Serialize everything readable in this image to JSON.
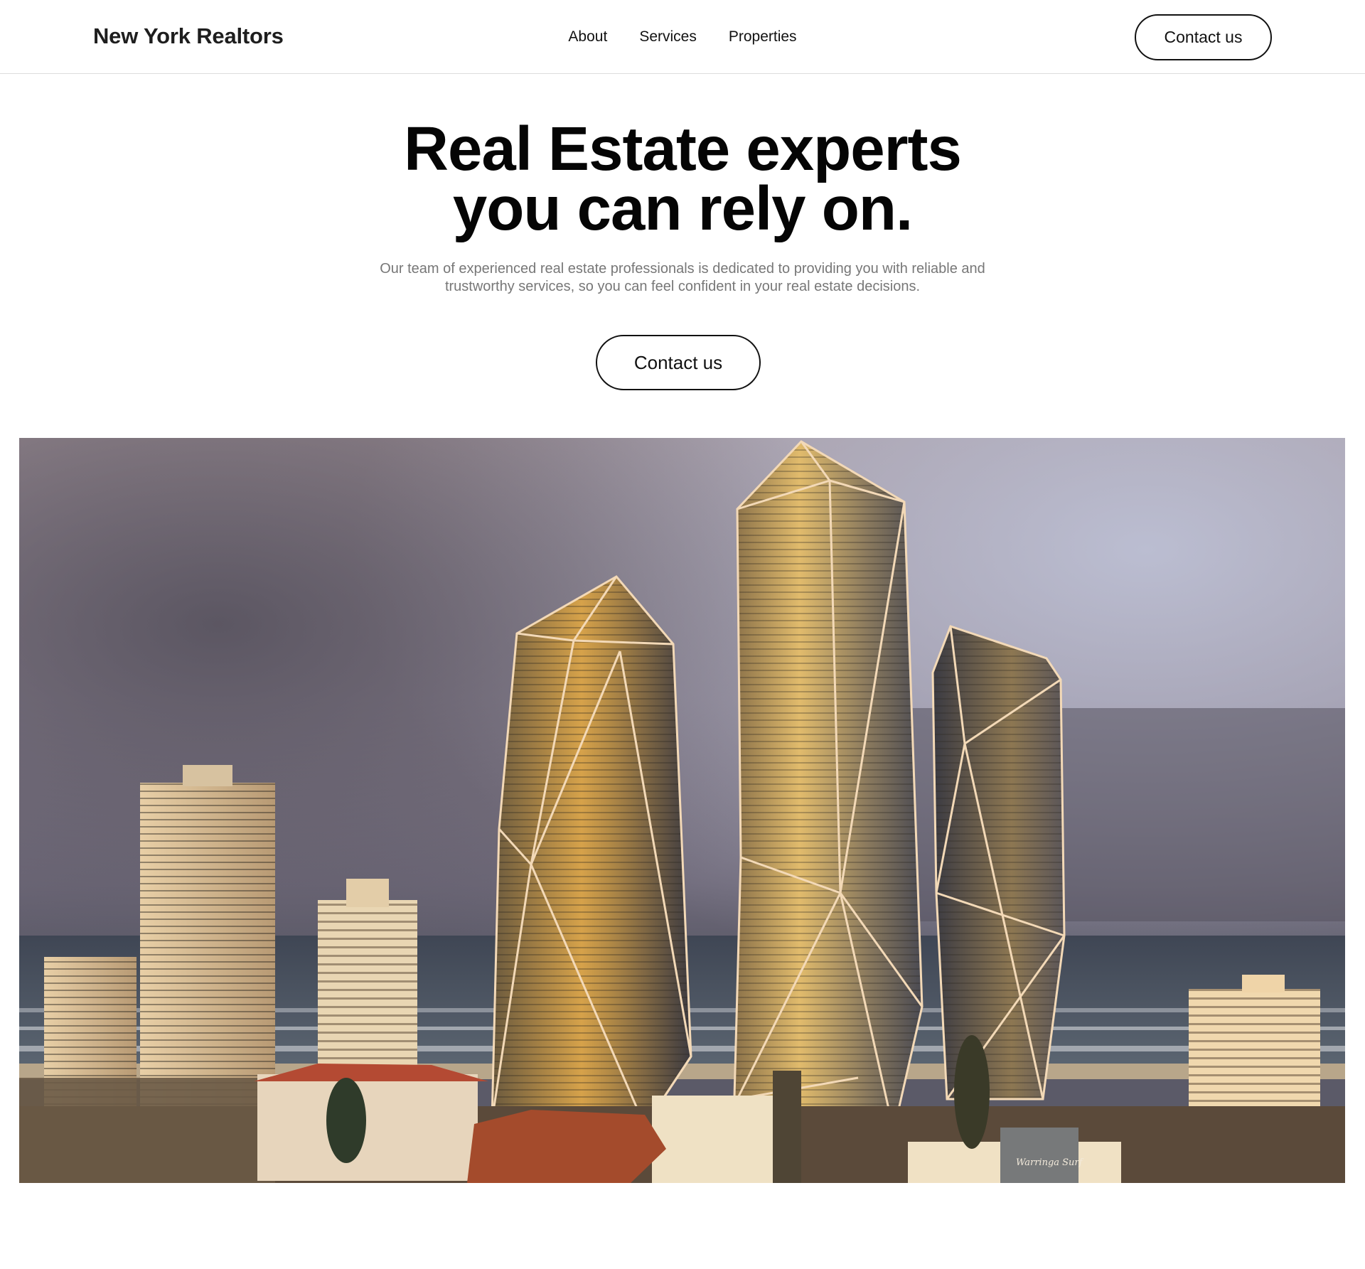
{
  "header": {
    "brand": "New York Realtors",
    "nav": [
      "About",
      "Services",
      "Properties"
    ],
    "contact_label": "Contact us"
  },
  "hero": {
    "title_line1": "Real Estate experts",
    "title_line2": "you can rely on.",
    "subtitle_line1": "Our team of experienced real estate professionals is dedicated to providing you with reliable and",
    "subtitle_line2": "trustworthy services, so you can feel confident in your real estate decisions.",
    "contact_label": "Contact us"
  },
  "image": {
    "signage_1": "Warringa Surf"
  },
  "colors": {
    "text_primary": "#050505",
    "text_muted": "#777777",
    "border": "#111111",
    "background": "#ffffff"
  }
}
